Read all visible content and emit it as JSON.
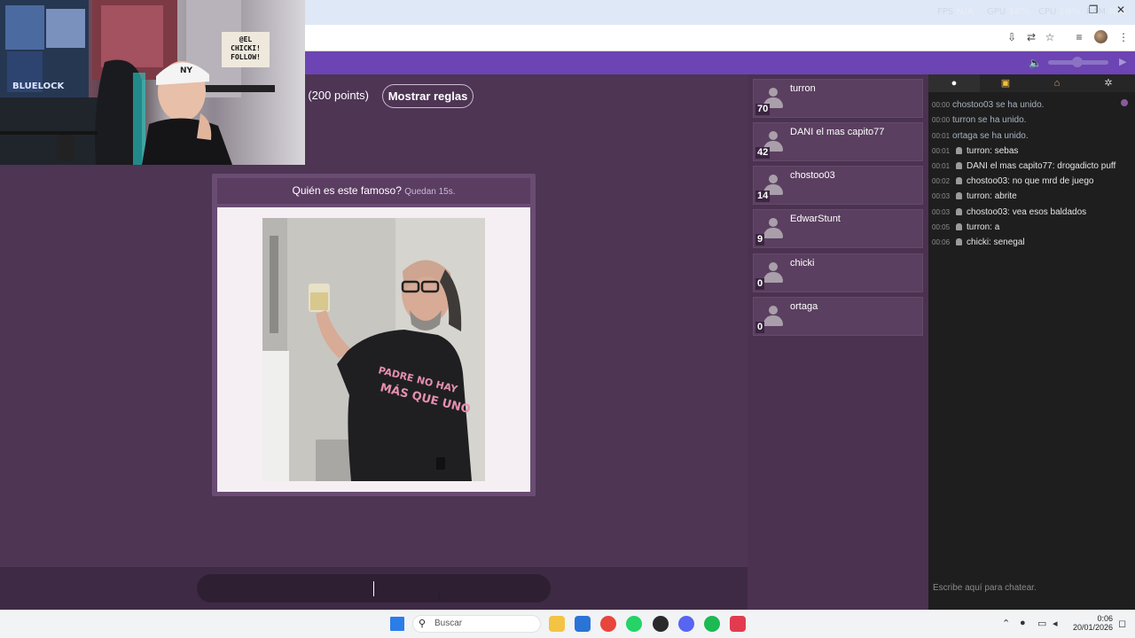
{
  "browser": {
    "perf": [
      {
        "label": "FPS",
        "value": "N/A"
      },
      {
        "label": "GPU",
        "value": "10%"
      },
      {
        "label": "CPU",
        "value": "10%"
      },
      {
        "label": "RAM",
        "value": "N/A"
      }
    ]
  },
  "game": {
    "mode_text": "sh (200 points)",
    "rules_button": "Mostrar reglas",
    "question": "Quién es este famoso?",
    "timer": "Quedan 15s.",
    "answer_value": ""
  },
  "stream_overlay": {
    "sign_lines": [
      "@EL",
      "CHICKI!",
      "FOLLOW!"
    ],
    "poster_text": "BLUELOCK",
    "cap_text": "NY"
  },
  "players": [
    {
      "name": "turron",
      "score": "70"
    },
    {
      "name": "DANI el mas capito77",
      "score": "42"
    },
    {
      "name": "chostoo03",
      "score": "14"
    },
    {
      "name": "EdwarStunt",
      "score": "9"
    },
    {
      "name": "chicki",
      "score": "0"
    },
    {
      "name": "ortaga",
      "score": "0"
    }
  ],
  "chat": {
    "tabs": [
      "chat-icon",
      "trophy-icon",
      "home-icon",
      "settings-icon"
    ],
    "messages": [
      {
        "time": "00:00",
        "text": "chostoo03 se ha unido.",
        "system": true
      },
      {
        "time": "00:00",
        "text": "turron se ha unido.",
        "system": true
      },
      {
        "time": "00:01",
        "text": "ortaga se ha unido.",
        "system": true
      },
      {
        "time": "00:01",
        "text": "turron: sebas",
        "system": false
      },
      {
        "time": "00:01",
        "text": "DANI el mas capito77: drogadicto puff",
        "system": false
      },
      {
        "time": "00:02",
        "text": "chostoo03: no que mrd de juego",
        "system": false
      },
      {
        "time": "00:03",
        "text": "turron: abrite",
        "system": false
      },
      {
        "time": "00:03",
        "text": "chostoo03: vea esos baldados",
        "system": false
      },
      {
        "time": "00:05",
        "text": "turron: a",
        "system": false
      },
      {
        "time": "00:06",
        "text": "chicki: senegal",
        "system": false
      }
    ],
    "input_placeholder": "Escribe aquí para chatear."
  },
  "taskbar": {
    "search_placeholder": "Buscar",
    "time": "0:06",
    "date": "20/01/2026",
    "colors": {
      "chrome": "#e8453c",
      "whatsapp": "#25d366",
      "spotify": "#1db954",
      "discord": "#5865f2"
    }
  }
}
